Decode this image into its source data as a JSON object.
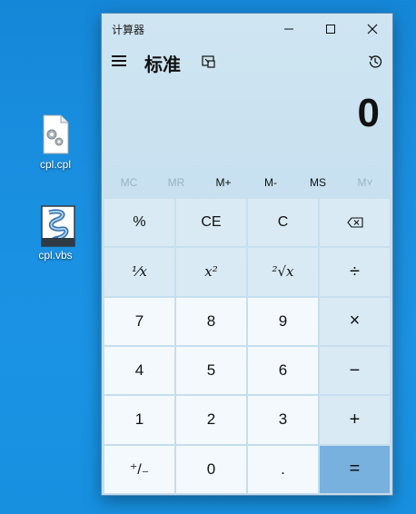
{
  "desktop": {
    "icons": [
      {
        "label": "cpl.cpl",
        "icon": "settings-file-icon"
      },
      {
        "label": "cpl.vbs",
        "icon": "vbs-script-icon"
      }
    ]
  },
  "window": {
    "title": "计算器",
    "controls": {
      "minimize": "—",
      "maximize": "☐",
      "close": "✕"
    }
  },
  "header": {
    "mode_title": "标准",
    "menu_icon": "hamburger-icon",
    "keep_on_top_icon": "keep-on-top-icon",
    "history_icon": "history-icon"
  },
  "display": {
    "value": "0"
  },
  "memory": {
    "items": [
      {
        "label": "MC",
        "enabled": false
      },
      {
        "label": "MR",
        "enabled": false
      },
      {
        "label": "M+",
        "enabled": true
      },
      {
        "label": "M-",
        "enabled": true
      },
      {
        "label": "MS",
        "enabled": true
      },
      {
        "label": "M˅",
        "enabled": false
      }
    ]
  },
  "keys": {
    "percent": "%",
    "ce": "CE",
    "c": "C",
    "reciprocal": "¹⁄x",
    "square": "x²",
    "sqrt": "²√x",
    "divide": "÷",
    "multiply": "×",
    "minus": "−",
    "plus": "+",
    "n7": "7",
    "n8": "8",
    "n9": "9",
    "n4": "4",
    "n5": "5",
    "n6": "6",
    "n1": "1",
    "n2": "2",
    "n3": "3",
    "negate": "⁺/₋",
    "n0": "0",
    "decimal": ".",
    "equals": "="
  },
  "colors": {
    "accent_equals": "#78b0de",
    "number_key": "#f3f9fc",
    "operator_key": "#d9eaf4",
    "window_bg": "#c9e1ef",
    "desktop_bg": "#1a8fe0"
  }
}
